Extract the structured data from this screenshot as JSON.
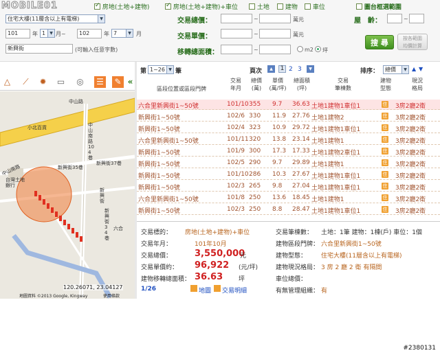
{
  "watermark": "MOBILE01",
  "filters": {
    "types": [
      {
        "label": "房地(土地+建物)",
        "checked": true
      },
      {
        "label": "房地(土地+建物)+車位",
        "checked": true
      },
      {
        "label": "土地",
        "checked": false
      },
      {
        "label": "建物",
        "checked": false
      },
      {
        "label": "車位",
        "checked": false
      }
    ],
    "map_range_label": "圖台框選範圍",
    "building_type": "住宅大樓(11層含以上有電梯)",
    "from_year": "101",
    "from_month": "1",
    "to_year": "102",
    "to_month": "7",
    "year_label": "年",
    "month_to_label": "月~",
    "month_label": "月",
    "road_value": "新興街",
    "road_hint": "(可輸入任意字數)",
    "total_price_label": "交易總價：",
    "unit_price_label": "交易單價：",
    "area_label": "移轉總面積：",
    "age_label": "屋　齡：",
    "tilde": "~",
    "wan_label": "萬元",
    "unit_m2": "m2",
    "unit_ping": "坪",
    "search_button": "搜 尋",
    "calc_button_line1": "按各範圍",
    "calc_button_line2": "均價計算"
  },
  "pager": {
    "range_prefix": "第",
    "range_value": "1~26",
    "range_suffix": "筆",
    "pages_label": "頁次",
    "pages": [
      "1",
      "2",
      "3"
    ],
    "sort_label": "排序：",
    "sort_value": "總價"
  },
  "columns": [
    {
      "label": "區段位置或區段門牌"
    },
    {
      "label": "交易\n年月"
    },
    {
      "label": "總價\n(萬)"
    },
    {
      "label": "單價\n(萬/坪)"
    },
    {
      "label": "總面積\n(坪)"
    },
    {
      "label": "交易\n筆棟數"
    },
    {
      "label": "建物\n型態"
    },
    {
      "label": "現況\n格局"
    }
  ],
  "rows": [
    {
      "address": "六合里新興街1~50號",
      "date": "101/10",
      "total": "355",
      "unit": "9.7",
      "area": "36.63",
      "count": "土地1建物1車位1",
      "type": "住",
      "layout": "3房2廳2衛",
      "highlight": true
    },
    {
      "address": "新興街1~50號",
      "date": "102/6",
      "total": "330",
      "unit": "11.9",
      "area": "27.76",
      "count": "土地1建物2",
      "type": "住",
      "layout": "3房2廳2衛",
      "highlight": false
    },
    {
      "address": "新興街1~50號",
      "date": "102/4",
      "total": "323",
      "unit": "10.9",
      "area": "29.72",
      "count": "土地1建物1車位1",
      "type": "住",
      "layout": "3房2廳2衛",
      "highlight": false
    },
    {
      "address": "六合里新興街1~50號",
      "date": "101/11",
      "total": "320",
      "unit": "13.8",
      "area": "23.14",
      "count": "土地1建物1",
      "type": "住",
      "layout": "3房2廳2衛",
      "highlight": false
    },
    {
      "address": "新興街1~50號",
      "date": "101/9",
      "total": "300",
      "unit": "17.3",
      "area": "17.33",
      "count": "土地1建物2車位1",
      "type": "住",
      "layout": "3房2廳2衛",
      "highlight": false
    },
    {
      "address": "新興街1~50號",
      "date": "102/5",
      "total": "290",
      "unit": "9.7",
      "area": "29.89",
      "count": "土地1建物1",
      "type": "住",
      "layout": "3房2廳2衛",
      "highlight": false
    },
    {
      "address": "新興街1~50號",
      "date": "101/10",
      "total": "286",
      "unit": "10.3",
      "area": "27.67",
      "count": "土地1建物1車位1",
      "type": "住",
      "layout": "3房2廳2衛",
      "highlight": false
    },
    {
      "address": "新興街1~50號",
      "date": "102/3",
      "total": "265",
      "unit": "9.8",
      "area": "27.04",
      "count": "土地1建物1車位1",
      "type": "住",
      "layout": "3房2廳2衛",
      "highlight": false
    },
    {
      "address": "六合里新興街1~50號",
      "date": "101/8",
      "total": "250",
      "unit": "13.6",
      "area": "18.45",
      "count": "土地1建物1",
      "type": "住",
      "layout": "3房2廳2衛",
      "highlight": false
    },
    {
      "address": "新興街1~50號",
      "date": "102/3",
      "total": "250",
      "unit": "8.8",
      "area": "28.47",
      "count": "土地1建物1車位1",
      "type": "住",
      "layout": "3房2廳2衛",
      "highlight": false
    }
  ],
  "detail": {
    "target_label": "交易標的：",
    "target": "房地(土地+建物)+車位",
    "date_label": "交易年月：",
    "date": "101年10月",
    "total_label": "交易總價：",
    "total": "3,550,000",
    "total_unit": "元",
    "unit_label": "交易單價約：",
    "unit": "96,922",
    "unit_unit": "(元/坪)",
    "area_label": "建物移轉總面積：",
    "area": "36.63",
    "area_unit": "坪",
    "count_label": "交易筆棟數：",
    "count": "土地：1筆 建物：1棟(戶) 車位：1個",
    "address_label": "建物區段門牌：",
    "address": "六合里新興街1~50號",
    "type_label": "建物型態：",
    "type": "住宅大樓(11層含以上有電梯)",
    "layout_label": "建物現況格局：",
    "layout": "3 房 2 廳 2 衛 有隔間",
    "parking_label": "車位總價：",
    "parking": "",
    "mgmt_label": "有無管理組織：",
    "mgmt": "有",
    "index": "1/26",
    "map_link": "地圖",
    "detail_link": "交易明細"
  },
  "map": {
    "labels": [
      "小北百貨",
      "中山南路",
      "新興街35巷",
      "新興街37巷",
      "台灣土地銀行",
      "中山南路104巷",
      "新興街",
      "新興街34巷",
      "六合",
      "中山路"
    ],
    "coords": "120.26071, 23.04127",
    "credit": "地圖資料 ©2013 Google, Kingway",
    "terms": "使用條款",
    "collapse": "«"
  },
  "image_id": "#2380131"
}
